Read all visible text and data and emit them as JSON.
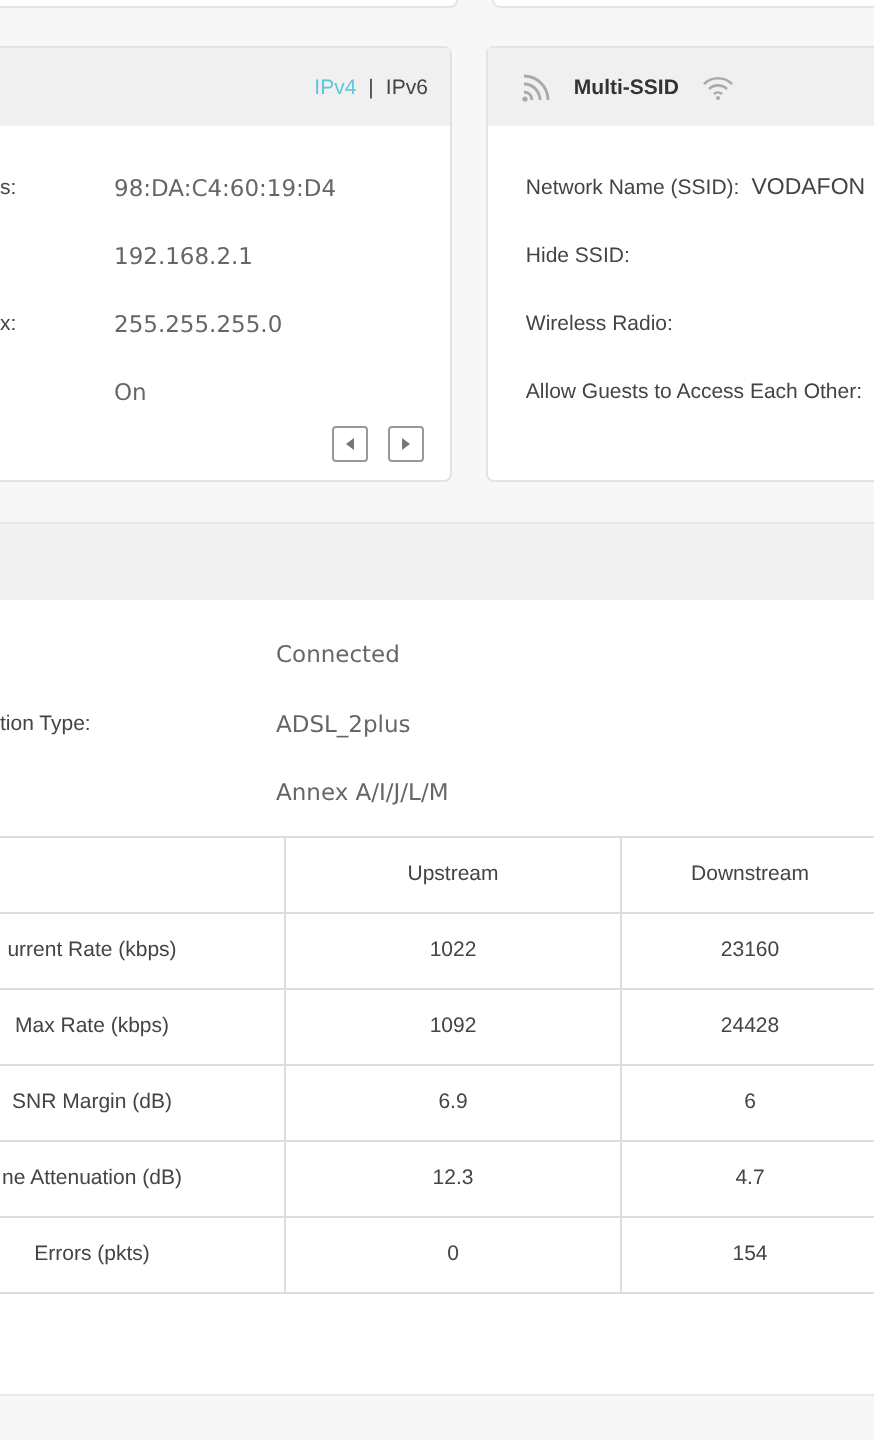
{
  "lan_card": {
    "tabs": [
      {
        "label": "IPv4",
        "selected": true
      },
      {
        "label": "IPv6",
        "selected": false
      }
    ],
    "tab_separator": "|",
    "rows": [
      {
        "label": "s:",
        "value": "98:DA:C4:60:19:D4"
      },
      {
        "value": "192.168.2.1"
      },
      {
        "label": "x:",
        "value": "255.255.255.0"
      },
      {
        "value": "On"
      }
    ]
  },
  "multi_ssid_card": {
    "title": "Multi-SSID",
    "rows": [
      {
        "label": "Network Name (SSID):",
        "value": "VODAFON"
      },
      {
        "label": "Hide SSID:"
      },
      {
        "label": "Wireless Radio:"
      },
      {
        "label": "Allow Guests to Access Each Other:"
      }
    ]
  },
  "dsl_section": {
    "rows": [
      {
        "value": "Connected"
      },
      {
        "label": "tion Type:",
        "value": "ADSL_2plus"
      },
      {
        "value": "Annex A/I/J/L/M"
      }
    ],
    "table": {
      "columns": [
        "Upstream",
        "Downstream"
      ],
      "rows": [
        {
          "label": "urrent Rate (kbps)",
          "values": [
            "1022",
            "23160"
          ]
        },
        {
          "label": "Max Rate (kbps)",
          "values": [
            "1092",
            "24428"
          ]
        },
        {
          "label": "SNR Margin (dB)",
          "values": [
            "6.9",
            "6"
          ]
        },
        {
          "label": "ne Attenuation (dB)",
          "values": [
            "12.3",
            "4.7"
          ]
        },
        {
          "label": "Errors (pkts)",
          "values": [
            "0",
            "154"
          ]
        }
      ]
    }
  }
}
